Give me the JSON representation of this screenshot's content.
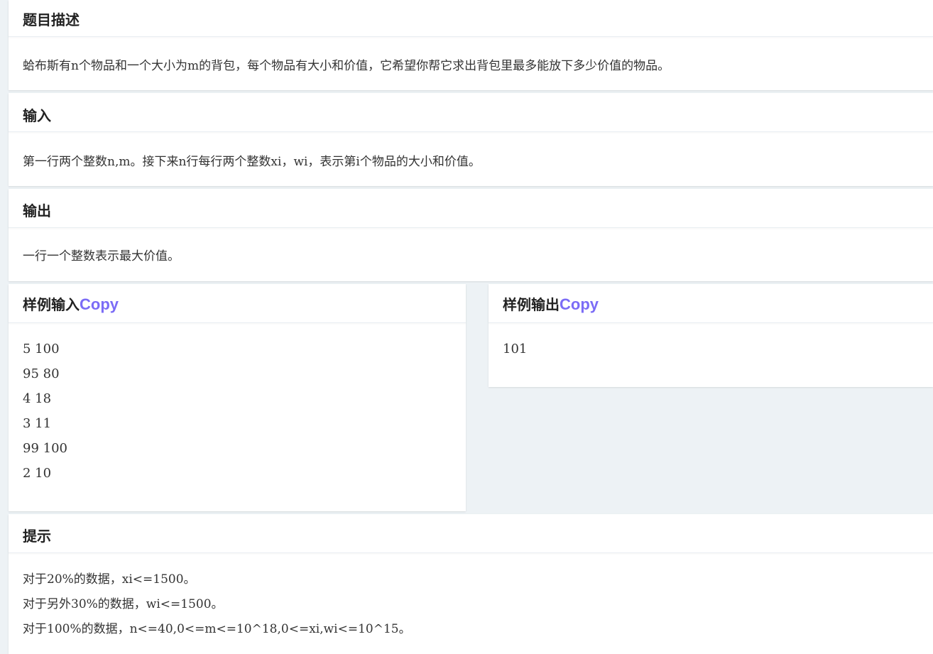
{
  "description": {
    "title": "题目描述",
    "text": "蛤布斯有n个物品和一个大小为m的背包，每个物品有大小和价值，它希望你帮它求出背包里最多能放下多少价值的物品。"
  },
  "input": {
    "title": "输入",
    "text": "第一行两个整数n,m。接下来n行每行两个整数xi，wi，表示第i个物品的大小和价值。"
  },
  "output": {
    "title": "输出",
    "text": "一行一个整数表示最大价值。"
  },
  "sample_input": {
    "title": "样例输入",
    "copy_label": "Copy",
    "lines": [
      "5 100",
      "95 80",
      "4 18",
      "3 11",
      "99 100",
      "2 10"
    ]
  },
  "sample_output": {
    "title": "样例输出",
    "copy_label": "Copy",
    "lines": [
      "101"
    ]
  },
  "hint": {
    "title": "提示",
    "lines": [
      "对于20%的数据，xi<=1500。",
      "对于另外30%的数据，wi<=1500。",
      "对于100%的数据，n<=40,0<=m<=10^18,0<=xi,wi<=10^15。"
    ]
  },
  "colors": {
    "page_background": "#edf2f5",
    "card_background": "#ffffff",
    "copy_link": "#7b6cf6"
  }
}
